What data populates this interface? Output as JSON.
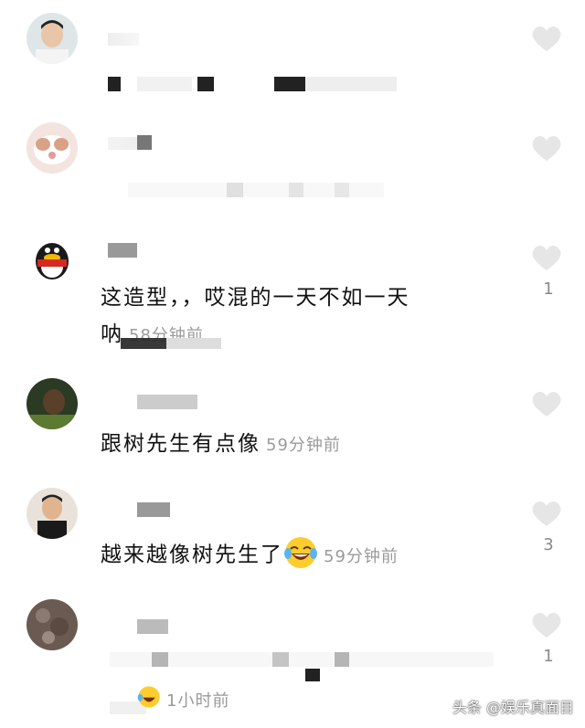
{
  "comments": [
    {
      "text": "",
      "time": "",
      "likes": ""
    },
    {
      "text": "",
      "time": "",
      "likes": ""
    },
    {
      "text_line1": "这造型，，哎混的一天不如一天",
      "text_line2": "呐",
      "time": "58分钟前",
      "likes": "1"
    },
    {
      "text": "跟树先生有点像",
      "time": "59分钟前",
      "likes": ""
    },
    {
      "text": "越来越像树先生了",
      "emoji": "laughing-crying-face",
      "time": "59分钟前",
      "likes": "3"
    },
    {
      "text": "",
      "time": "1小时前",
      "likes": "1"
    }
  ],
  "watermark": "头条 @娱乐真面目",
  "colors": {
    "like_icon": "#e6e6e6",
    "time_text": "#9a9a9a",
    "count_text": "#8a8a8a"
  }
}
